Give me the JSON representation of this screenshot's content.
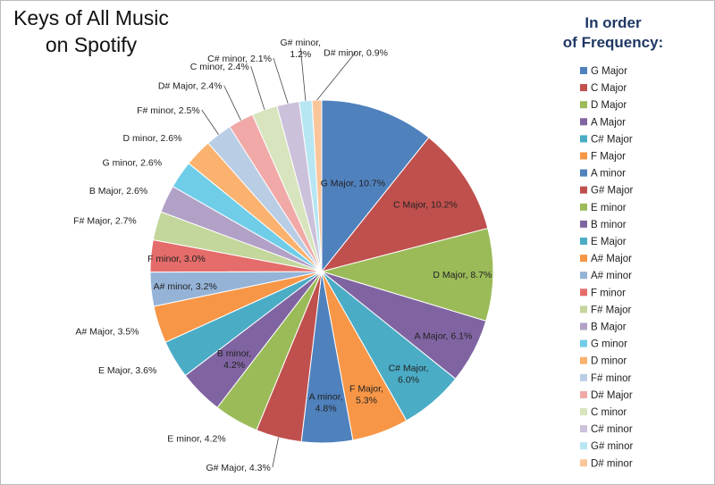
{
  "chart_data": {
    "type": "pie",
    "title": "Keys of All Music\non Spotify",
    "legend_title": "In order\nof Frequency:",
    "legend_position": "right",
    "slices": [
      {
        "name": "G Major",
        "value": 10.7,
        "label": "G Major, 10.7%",
        "color": "#4f81bd"
      },
      {
        "name": "C Major",
        "value": 10.2,
        "label": "C Major, 10.2%",
        "color": "#c0504d"
      },
      {
        "name": "D Major",
        "value": 8.7,
        "label": "D Major, 8.7%",
        "color": "#9bbb59"
      },
      {
        "name": "A Major",
        "value": 6.1,
        "label": "A Major, 6.1%",
        "color": "#8064a2"
      },
      {
        "name": "C# Major",
        "value": 6.0,
        "label": "C# Major,\n6.0%",
        "color": "#4bacc6"
      },
      {
        "name": "F Major",
        "value": 5.3,
        "label": "F Major,\n5.3%",
        "color": "#f79646"
      },
      {
        "name": "A minor",
        "value": 4.8,
        "label": "A minor,\n4.8%",
        "color": "#4f81bd"
      },
      {
        "name": "G# Major",
        "value": 4.3,
        "label": "G# Major, 4.3%",
        "color": "#c0504d"
      },
      {
        "name": "E minor",
        "value": 4.2,
        "label": "E minor, 4.2%",
        "color": "#9bbb59"
      },
      {
        "name": "B minor",
        "value": 4.2,
        "label": "B minor,\n4.2%",
        "color": "#8064a2"
      },
      {
        "name": "E Major",
        "value": 3.6,
        "label": "E Major, 3.6%",
        "color": "#4bacc6"
      },
      {
        "name": "A# Major",
        "value": 3.5,
        "label": "A# Major, 3.5%",
        "color": "#f79646"
      },
      {
        "name": "A# minor",
        "value": 3.2,
        "label": "A# minor, 3.2%",
        "color": "#95b3d7"
      },
      {
        "name": "F minor",
        "value": 3.0,
        "label": "F minor, 3.0%",
        "color": "#e46c6a"
      },
      {
        "name": "F# Major",
        "value": 2.7,
        "label": "F# Major, 2.7%",
        "color": "#c3d69b"
      },
      {
        "name": "B Major",
        "value": 2.6,
        "label": "B Major, 2.6%",
        "color": "#b2a1c7"
      },
      {
        "name": "G minor",
        "value": 2.6,
        "label": "G minor, 2.6%",
        "color": "#6fcde8"
      },
      {
        "name": "D minor",
        "value": 2.6,
        "label": "D minor, 2.6%",
        "color": "#fab26e"
      },
      {
        "name": "F# minor",
        "value": 2.5,
        "label": "F# minor, 2.5%",
        "color": "#b9cde5"
      },
      {
        "name": "D# Major",
        "value": 2.4,
        "label": "D# Major, 2.4%",
        "color": "#f0a9a7"
      },
      {
        "name": "C minor",
        "value": 2.4,
        "label": "C minor, 2.4%",
        "color": "#d7e4bd"
      },
      {
        "name": "C# minor",
        "value": 2.1,
        "label": "C# minor, 2.1%",
        "color": "#ccc1da"
      },
      {
        "name": "G# minor",
        "value": 1.2,
        "label": "G# minor,\n1.2%",
        "color": "#b7e6f3"
      },
      {
        "name": "D# minor",
        "value": 0.9,
        "label": "D# minor, 0.9%",
        "color": "#fbc59a"
      }
    ]
  }
}
